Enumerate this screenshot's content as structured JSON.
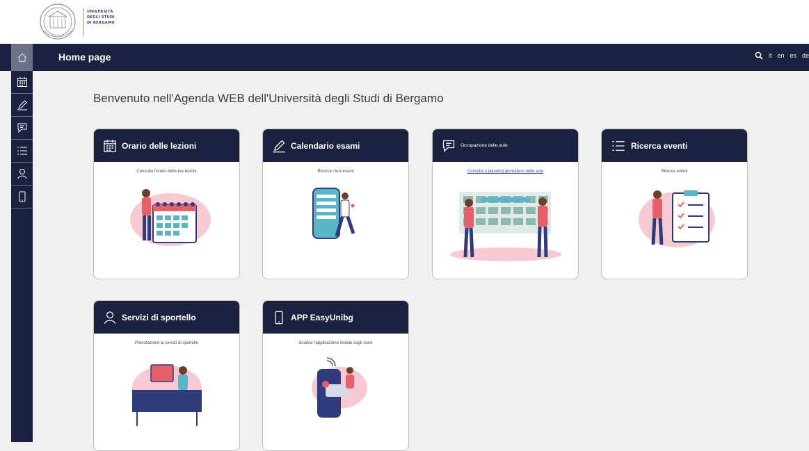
{
  "logo": {
    "lines": [
      "UNIVERSITÀ",
      "DEGLI STUDI",
      "DI BERGAMO"
    ]
  },
  "navbar": {
    "title": "Home page",
    "languages": [
      "it",
      "en",
      "es",
      "de"
    ]
  },
  "sidebar": {
    "items": [
      {
        "icon": "calendar-icon"
      },
      {
        "icon": "pen-icon"
      },
      {
        "icon": "chat-icon"
      },
      {
        "icon": "list-icon"
      },
      {
        "icon": "person-icon"
      },
      {
        "icon": "phone-icon"
      }
    ]
  },
  "main": {
    "welcome": "Benvenuto nell'Agenda WEB dell'Università degli Studi di Bergamo",
    "cards": [
      {
        "title": "Orario delle lezioni",
        "desc": "Consulta l'orario delle tue lezioni",
        "icon": "calendar-icon"
      },
      {
        "title": "Calendario esami",
        "desc": "Ricerca i tuoi esami",
        "icon": "pen-icon"
      },
      {
        "title": "Occupazione delle aule",
        "desc": "Consulta il planning giornaliero delle aule",
        "icon": "chat-icon"
      },
      {
        "title": "Ricerca eventi",
        "desc": "Ricerca eventi",
        "icon": "list-icon"
      },
      {
        "title": "Servizi di sportello",
        "desc": "Prenotazione ai servizi di sportello",
        "icon": "person-icon"
      },
      {
        "title": "APP EasyUnibg",
        "desc": "Scarica l'applicazione mobile dagli store",
        "icon": "phone-icon"
      }
    ]
  },
  "colors": {
    "navy": "#1c2140",
    "background": "#f0f0f0",
    "illustration_blue": "#2f3b7a",
    "illustration_pink": "#f6c9d3",
    "illustration_red": "#e4606b"
  }
}
